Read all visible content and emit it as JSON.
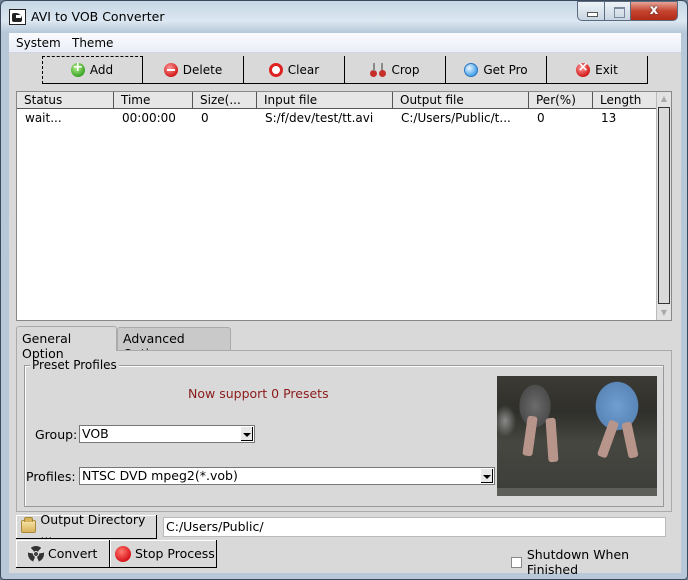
{
  "window": {
    "title": "AVI to VOB Converter",
    "controls": {
      "minimize": "minimize",
      "maximize": "maximize",
      "close": "x"
    }
  },
  "menu": {
    "items": [
      {
        "label": "System"
      },
      {
        "label": "Theme"
      }
    ]
  },
  "toolbar": {
    "buttons": [
      {
        "label": "Add",
        "icon": "add-icon"
      },
      {
        "label": "Delete",
        "icon": "delete-icon"
      },
      {
        "label": "Clear",
        "icon": "clear-icon"
      },
      {
        "label": "Crop",
        "icon": "crop-icon"
      },
      {
        "label": "Get Pro",
        "icon": "get-pro-icon"
      },
      {
        "label": "Exit",
        "icon": "exit-icon"
      }
    ]
  },
  "file_list": {
    "columns": [
      "Status",
      "Time",
      "Size(...",
      "Input file",
      "Output file",
      "Per(%)",
      "Length"
    ],
    "rows": [
      [
        "wait...",
        "00:00:00",
        "0",
        "S:/f/dev/test/tt.avi",
        "C:/Users/Public/t...",
        "0",
        "13"
      ]
    ]
  },
  "tabs": [
    {
      "label": "General Option",
      "active": true
    },
    {
      "label": "Advanced Option",
      "active": false
    }
  ],
  "preset_profiles": {
    "title": "Preset Profiles",
    "message": "Now support 0 Presets",
    "message_color": "#8b1b1b",
    "group_label": "Group:",
    "group_value": "VOB",
    "profiles_label": "Profiles:",
    "profiles_value": "NTSC DVD mpeg2(*.vob)"
  },
  "output": {
    "directory_button": "Output Directory ...",
    "directory_value": "C:/Users/Public/"
  },
  "actions": {
    "convert": "Convert",
    "stop": "Stop Process",
    "shutdown_label": "Shutdown When Finished",
    "shutdown_checked": false
  }
}
